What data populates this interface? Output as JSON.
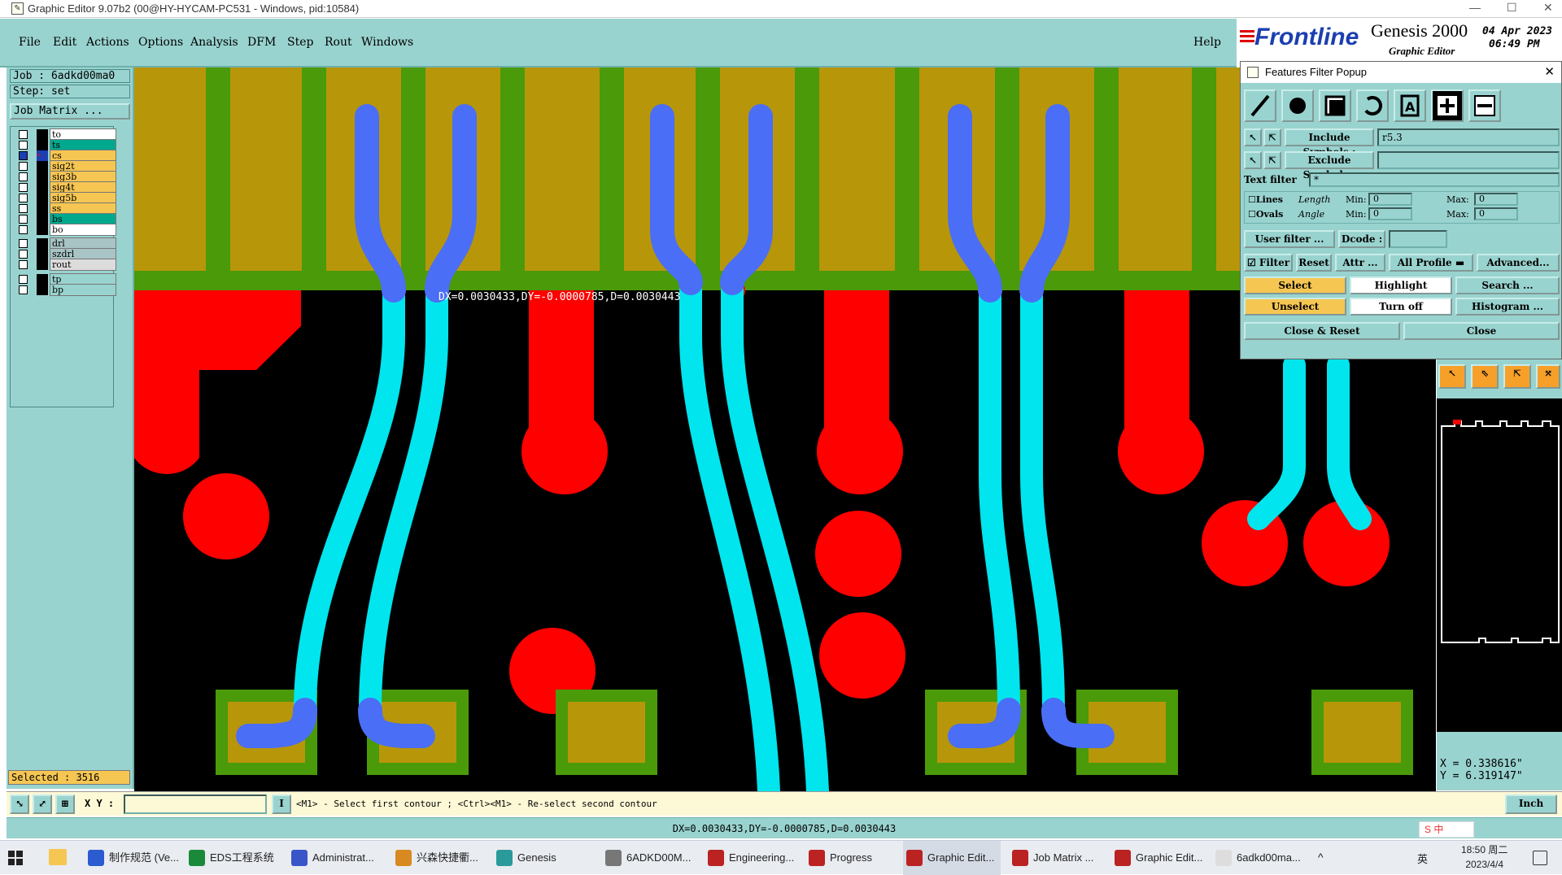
{
  "window": {
    "title": "Graphic Editor 9.07b2 (00@HY-HYCAM-PC531 - Windows, pid:10584)",
    "minimize": "—",
    "maximize": "☐",
    "close": "✕"
  },
  "menu": [
    "File",
    "Edit",
    "Actions",
    "Options",
    "Analysis",
    "DFM",
    "Step",
    "Rout",
    "Windows"
  ],
  "help": "Help",
  "logo": {
    "brand": "Frontline",
    "product": "Genesis 2000",
    "subtitle": "Graphic Editor",
    "date": "04 Apr 2023",
    "time": "06:49 PM"
  },
  "left": {
    "job": "Job : 6adkd00ma0",
    "step": "Step: set",
    "job_matrix": "Job Matrix ...",
    "layers": [
      {
        "name": "to",
        "color": "#ffffff"
      },
      {
        "name": "ts",
        "color": "#00a88e"
      },
      {
        "name": "cs",
        "color": "#f6c653",
        "active": true
      },
      {
        "name": "sig2t",
        "color": "#f6c653"
      },
      {
        "name": "sig3b",
        "color": "#f6c653"
      },
      {
        "name": "sig4t",
        "color": "#f6c653"
      },
      {
        "name": "sig5b",
        "color": "#f6c653"
      },
      {
        "name": "ss",
        "color": "#f6c653"
      },
      {
        "name": "bs",
        "color": "#00a88e"
      },
      {
        "name": "bo",
        "color": "#ffffff"
      },
      {
        "name": "drl",
        "color": "#a8c4c4"
      },
      {
        "name": "szdrl",
        "color": "#a8c4c4"
      },
      {
        "name": "rout",
        "color": "#dcdcdc"
      },
      {
        "name": "tp",
        "color": "#99d3cf"
      },
      {
        "name": "bp",
        "color": "#99d3cf"
      }
    ],
    "selected": "Selected : 3516"
  },
  "canvas": {
    "measure": "DX=0.0030433,DY=-0.0000785,D=0.0030443"
  },
  "popup": {
    "title": "Features Filter Popup",
    "include_label": "Include Symbols :",
    "include_value": "r5.3",
    "exclude_label": "Exclude Symbols :",
    "exclude_value": "",
    "text_filter_label": "Text filter",
    "text_filter_value": "*",
    "lines": "Lines",
    "ovals": "Ovals",
    "length": "Length",
    "angle": "Angle",
    "min": "Min:",
    "max": "Max:",
    "zero": "0",
    "user_filter": "User filter ...",
    "dcode": "Dcode :",
    "filter": "Filter",
    "reset": "Reset",
    "attr": "Attr ...",
    "all_profile": "All Profile",
    "advanced": "Advanced...",
    "select": "Select",
    "highlight": "Highlight",
    "search": "Search ...",
    "unselect": "Unselect",
    "turn_off": "Turn off",
    "histogram": "Histogram ...",
    "close_reset": "Close & Reset",
    "close": "Close"
  },
  "coords": {
    "x": "X = 0.338616\"",
    "y": "Y = 6.319147\""
  },
  "command": {
    "xy_label": "X Y :",
    "xy_value": "",
    "prompt": "<M1> - Select first contour ; <Ctrl><M1> - Re-select second contour",
    "units": "Inch"
  },
  "status": "DX=0.0030433,DY=-0.0000785,D=0.0030443",
  "taskbar": {
    "items": [
      "制作规范 (Ve...",
      "EDS工程系统",
      "Administrat...",
      "兴森快捷衢...",
      "Genesis",
      "6ADKD00M...",
      "Engineering...",
      "Progress",
      "Graphic Edit...",
      "Job Matrix ...",
      "Graphic Edit...",
      "6adkd00ma..."
    ],
    "ime": "英",
    "clock_time": "18:50 周二",
    "clock_date": "2023/4/4",
    "ime_cn": "中"
  },
  "colors": {
    "panel": "#99d3cf",
    "copper": "#b8960a",
    "mask": "#4a9a0a",
    "pad": "#ff0000",
    "trace_cyan": "#00e5ee",
    "trace_blue": "#4a6ef5",
    "selected_yellow": "#f6c653"
  }
}
